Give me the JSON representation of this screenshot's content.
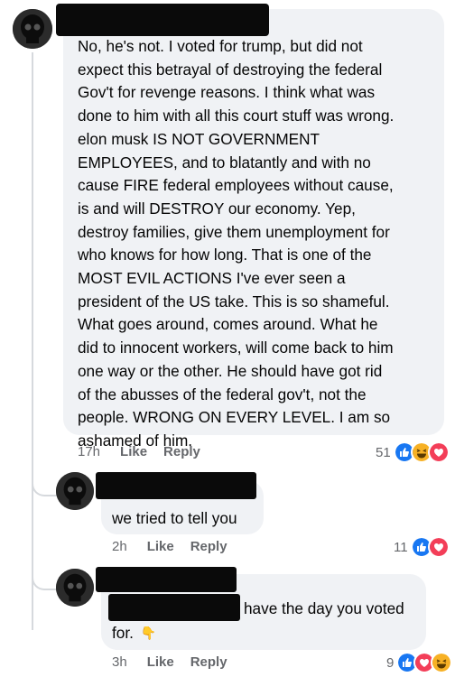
{
  "comments": [
    {
      "text": "No, he's not.  I voted for trump, but did not\nexpect this betrayal of destroying the federal\nGov't for revenge reasons.  I think what was\ndone to him with all this court stuff was wrong.\nelon musk IS NOT GOVERNMENT\nEMPLOYEES, and to blatantly and with no\ncause FIRE federal employees without cause,\nis and will DESTROY our economy.  Yep,\ndestroy families, give them unemployment for\nwho knows for how long. That is one of the\nMOST EVIL ACTIONS I've ever seen a\npresident of the US take.  This is so shameful.\nWhat goes around, comes around.  What he\ndid to innocent workers, will come back to him\none way or the other.  He should have got rid\nof the abusses of the federal gov't, not the\npeople.  WRONG ON EVERY LEVEL.  I am so\nashamed of him.",
      "time": "17h",
      "like_label": "Like",
      "reply_label": "Reply",
      "reaction_count": "51",
      "reactions": [
        "like-icon",
        "laugh-icon",
        "love-icon"
      ]
    },
    {
      "text": "we tried to tell you",
      "time": "2h",
      "like_label": "Like",
      "reply_label": "Reply",
      "reaction_count": "11",
      "reactions": [
        "like-icon",
        "love-icon"
      ]
    },
    {
      "text_line1": "have the day you voted",
      "text_line2": "for.",
      "emoji": "👇",
      "time": "3h",
      "like_label": "Like",
      "reply_label": "Reply",
      "reaction_count": "9",
      "reactions": [
        "like-icon",
        "love-icon",
        "laugh-icon"
      ]
    }
  ],
  "colors": {
    "bubble": "#f0f2f5",
    "meta_text": "#65676b",
    "like_blue": "#1877f2",
    "love_red": "#f33e58",
    "haha_yellow": "#f7b125"
  }
}
